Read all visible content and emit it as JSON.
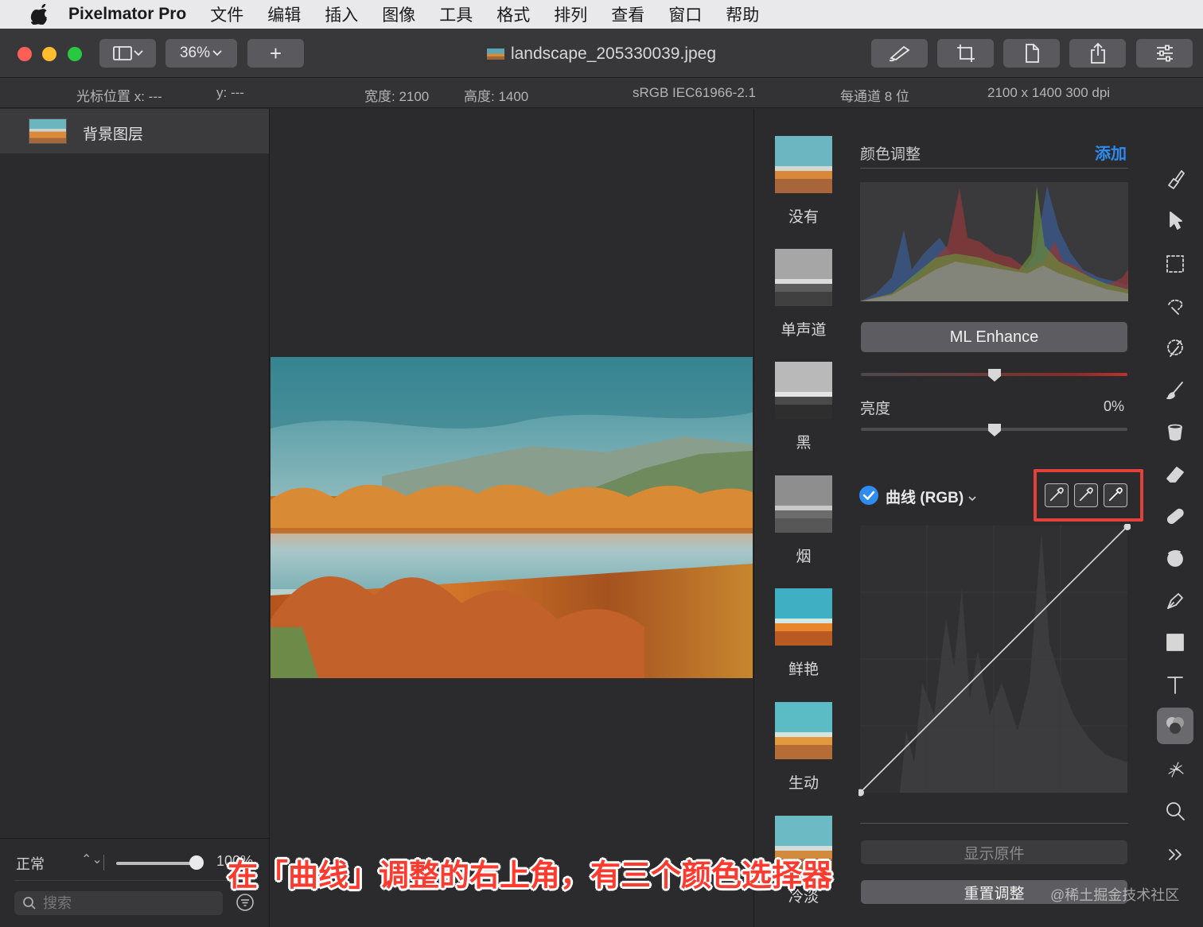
{
  "menubar": {
    "app_name": "Pixelmator Pro",
    "items": [
      "文件",
      "编辑",
      "插入",
      "图像",
      "工具",
      "格式",
      "排列",
      "查看",
      "窗口",
      "帮助"
    ]
  },
  "toolbar": {
    "zoom": "36%",
    "add_symbol": "+",
    "document_title": "landscape_205330039.jpeg"
  },
  "infobar": {
    "cursor_x": "光标位置 x:  ---",
    "cursor_y": "y:  ---",
    "width": "宽度:  2100",
    "height": "高度:  1400",
    "color_profile": "sRGB IEC61966-2.1",
    "bit_depth": "每通道 8 位",
    "resolution": "2100 x 1400 300 dpi"
  },
  "layers": {
    "items": [
      {
        "name": "背景图层"
      }
    ],
    "blend_mode": "正常",
    "opacity": "100%",
    "search_placeholder": "搜索"
  },
  "presets": {
    "items": [
      {
        "name": "没有"
      },
      {
        "name": "单声道"
      },
      {
        "name": "黑"
      },
      {
        "name": "烟"
      },
      {
        "name": "鲜艳"
      },
      {
        "name": "生动"
      },
      {
        "name": "冷淡"
      }
    ]
  },
  "adjustments": {
    "title": "颜色调整",
    "add_label": "添加",
    "ml_enhance": "ML Enhance",
    "brightness_label": "亮度",
    "brightness_value": "0%",
    "curves_label": "曲线 (RGB)",
    "show_original": "显示原件",
    "reset": "重置调整"
  },
  "overlay": {
    "caption": "在「曲线」调整的右上角，有三个颜色选择器",
    "watermark": "@稀土掘金技术社区"
  },
  "colors": {
    "accent": "#2e8cf0",
    "highlight_box": "#e2403a",
    "traffic_red": "#fe5f57",
    "traffic_yellow": "#febc2e",
    "traffic_green": "#28c840"
  }
}
